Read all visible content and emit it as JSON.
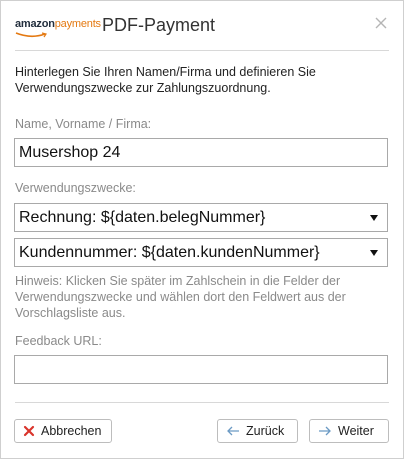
{
  "dialog": {
    "logo": {
      "part1": "amazon",
      "part2": "payments"
    },
    "title": "PDF-Payment"
  },
  "intro": "Hinterlegen Sie Ihren Namen/Firma und definieren Sie Verwendungszwecke zur Zahlungszuordnung.",
  "name_field": {
    "label": "Name, Vorname / Firma:",
    "value": "Musershop 24"
  },
  "purposes": {
    "label": "Verwendungszwecke:",
    "select1": "Rechnung: ${daten.belegNummer}",
    "select2": "Kundennummer: ${daten.kundenNummer}"
  },
  "hint": "Hinweis: Klicken Sie später im Zahlschein in die Felder der Verwendungszwecke und wählen dort den Feldwert aus der Vorschlagsliste aus.",
  "feedback": {
    "label": "Feedback URL:",
    "value": ""
  },
  "buttons": {
    "cancel": "Abbrechen",
    "back": "Zurück",
    "next": "Weiter"
  },
  "colors": {
    "cancel_icon": "#d9342b",
    "nav_icon": "#6b9ac4"
  }
}
